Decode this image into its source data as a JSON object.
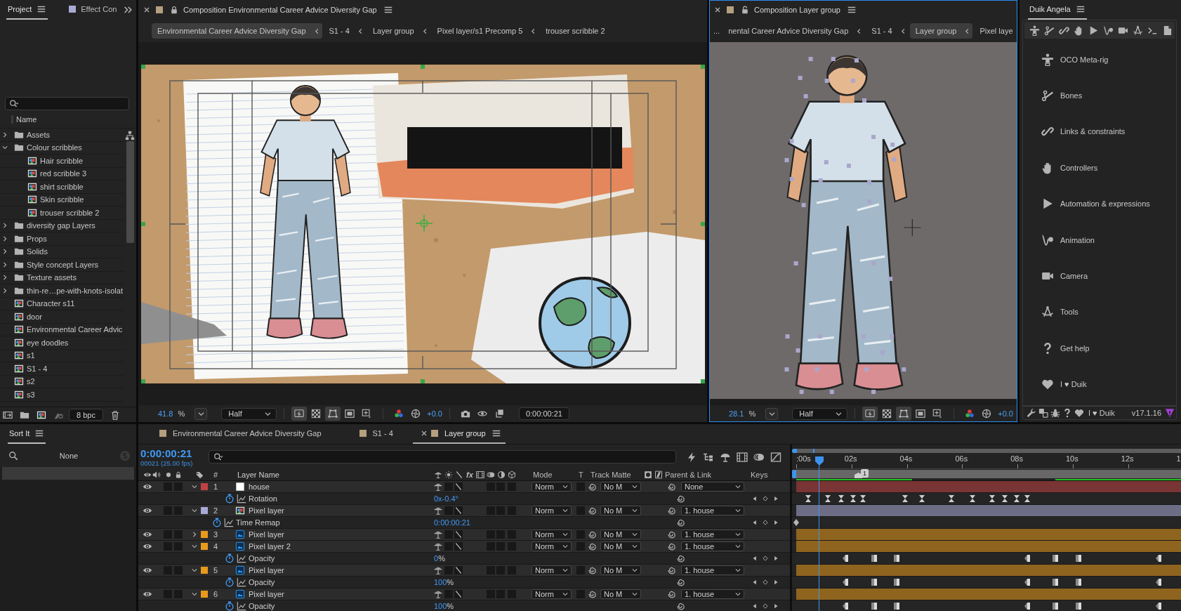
{
  "project": {
    "tabs": [
      {
        "label": "Project",
        "selected": true
      },
      {
        "label": "Effect Con",
        "selected": false,
        "color": "#a9a9d6"
      }
    ],
    "columns": [
      "Name"
    ],
    "items": [
      {
        "kind": "folder",
        "label": "Assets",
        "expanded": false
      },
      {
        "kind": "folder",
        "label": "Colour scribbles",
        "expanded": true,
        "children": [
          {
            "kind": "comp",
            "label": "Hair scribble"
          },
          {
            "kind": "comp",
            "label": "red scribble 3"
          },
          {
            "kind": "comp",
            "label": "shirt scribble"
          },
          {
            "kind": "comp",
            "label": "Skin scribble"
          },
          {
            "kind": "comp",
            "label": "trouser scribble 2"
          }
        ]
      },
      {
        "kind": "folder",
        "label": "diversity gap Layers",
        "expanded": false
      },
      {
        "kind": "folder",
        "label": "Props",
        "expanded": false
      },
      {
        "kind": "folder",
        "label": "Solids",
        "expanded": false
      },
      {
        "kind": "folder",
        "label": "Style concept Layers",
        "expanded": false
      },
      {
        "kind": "folder",
        "label": "Texture assets",
        "expanded": false
      },
      {
        "kind": "folder",
        "label": "thin-re…pe-with-knots-isolat",
        "expanded": false
      },
      {
        "kind": "comp",
        "label": "Character s11"
      },
      {
        "kind": "comp",
        "label": "door"
      },
      {
        "kind": "comp",
        "label": "Environmental Career Advic"
      },
      {
        "kind": "comp",
        "label": "eye doodles"
      },
      {
        "kind": "comp",
        "label": "s1"
      },
      {
        "kind": "comp",
        "label": "S1 - 4"
      },
      {
        "kind": "comp",
        "label": "s2"
      },
      {
        "kind": "comp",
        "label": "s3"
      }
    ],
    "bit_depth": "8 bpc"
  },
  "viewers": [
    {
      "kind": "composition",
      "active": false,
      "title": "Composition Environmental Career Advice Diversity Gap",
      "color": "#b49f7e",
      "locked": true,
      "breadcrumbs": [
        {
          "label": "Environmental Career Advice Diversity Gap",
          "selected": true
        },
        {
          "label": "S1 - 4",
          "selected": false
        },
        {
          "label": "Layer group",
          "selected": false
        },
        {
          "label": "Pixel layer/s1 Precomp 5",
          "selected": false
        },
        {
          "label": "trouser scribble 2",
          "selected": false
        }
      ],
      "magnification": "41.8",
      "unit": "%",
      "resolution": "Half",
      "toggles": [
        {
          "kind": "fast-preview",
          "on": true
        },
        {
          "kind": "transparency",
          "on": false
        },
        {
          "kind": "mask",
          "on": true
        },
        {
          "kind": "region",
          "on": false
        },
        {
          "kind": "grid",
          "on": false
        }
      ],
      "exposure": "+0.0",
      "timecode": "0:00:00:21"
    },
    {
      "kind": "layer",
      "active": true,
      "title": "Composition Layer group",
      "color": "#b49f7e",
      "locked": false,
      "breadcrumb_overflow": "...",
      "breadcrumbs": [
        {
          "label": "nental Career Advice Diversity Gap",
          "selected": false
        },
        {
          "label": "S1 - 4",
          "selected": false
        },
        {
          "label": "Layer group",
          "selected": true
        },
        {
          "label": "Pixel laye",
          "selected": false
        }
      ],
      "magnification": "28.1",
      "unit": "%",
      "resolution": "Half",
      "toggles": [
        {
          "kind": "fast-preview",
          "on": true
        },
        {
          "kind": "transparency",
          "on": false
        },
        {
          "kind": "mask",
          "on": true
        },
        {
          "kind": "region",
          "on": false
        },
        {
          "kind": "grid",
          "on": false
        }
      ],
      "exposure": "+0.0"
    }
  ],
  "duik": {
    "title": "Duik Angela",
    "toolbar": [
      {
        "kind": "meta-rig"
      },
      {
        "kind": "bones"
      },
      {
        "kind": "links"
      },
      {
        "kind": "controllers"
      },
      {
        "kind": "automation"
      },
      {
        "kind": "animation"
      },
      {
        "kind": "camera"
      },
      {
        "kind": "tools"
      },
      {
        "kind": "terminal"
      },
      {
        "kind": "document"
      }
    ],
    "items": [
      {
        "kind": "meta-rig",
        "label": "OCO Meta-rig"
      },
      {
        "kind": "bones",
        "label": "Bones"
      },
      {
        "kind": "links",
        "label": "Links & constraints"
      },
      {
        "kind": "controllers",
        "label": "Controllers"
      },
      {
        "kind": "automation",
        "label": "Automation & expressions"
      },
      {
        "kind": "animation",
        "label": "Animation"
      },
      {
        "kind": "camera",
        "label": "Camera"
      },
      {
        "kind": "tools",
        "label": "Tools"
      },
      {
        "kind": "help",
        "label": "Get help"
      },
      {
        "kind": "heart",
        "label": "I ♥ Duik"
      }
    ],
    "footer": {
      "tools": [
        {
          "kind": "settings"
        },
        {
          "kind": "translate"
        },
        {
          "kind": "bug"
        },
        {
          "kind": "help"
        },
        {
          "kind": "heart"
        }
      ],
      "credit": "I ♥ Duik",
      "version": "v17.1.16"
    }
  },
  "sort_it": {
    "title": "Sort It",
    "filter": "None",
    "rows": [
      {
        "selected": true
      }
    ]
  },
  "timeline": {
    "tabs": [
      {
        "label": "Environmental Career Advice Diversity Gap",
        "color": "#b49f7e",
        "selected": false
      },
      {
        "label": "S1 - 4",
        "color": "#b49f7e",
        "selected": false
      },
      {
        "label": "Layer group",
        "color": "#b49f7e",
        "selected": true
      }
    ],
    "timecode": "0:00:00:21",
    "frame_info": "00021 (25.00 fps)",
    "columns": {
      "number": "#",
      "layer_name": "Layer Name",
      "effects": "fx",
      "mode": "Mode",
      "preserve": "T",
      "track_matte": "Track Matte",
      "parent": "Parent & Link",
      "keys": "Keys"
    },
    "layers": [
      {
        "number": "1",
        "name": "house",
        "kind": "solid",
        "color": "#c04141",
        "visible": true,
        "solo": false,
        "locked": false,
        "expanded": true,
        "collapse": false,
        "motion_blur": false,
        "adjustment": false,
        "three_d": false,
        "mode": "Norm",
        "preserve_transparency": false,
        "track_matte": "No M",
        "parent": "None",
        "children": [
          {
            "kind": "transform",
            "name": "Rotation",
            "value": "0x-0.4°",
            "animated": true
          }
        ]
      },
      {
        "number": "2",
        "name": "Pixel layer",
        "kind": "comp",
        "color": "#a9a9d7",
        "visible": true,
        "solo": false,
        "locked": false,
        "expanded": true,
        "collapse": false,
        "motion_blur": false,
        "adjustment": false,
        "three_d": false,
        "mode": "Norm",
        "preserve_transparency": false,
        "track_matte": "No M",
        "parent": "1. house",
        "children": [
          {
            "kind": "layer-property",
            "name": "Time Remap",
            "value": "0:00:00:21",
            "animated": true
          }
        ]
      },
      {
        "number": "3",
        "name": "Pixel layer",
        "kind": "image",
        "color": "#e89a1c",
        "visible": true,
        "solo": false,
        "locked": false,
        "expanded": false,
        "collapse": false,
        "motion_blur": false,
        "adjustment": false,
        "three_d": false,
        "mode": "Norm",
        "preserve_transparency": false,
        "track_matte": "No M",
        "parent": "1. house"
      },
      {
        "number": "4",
        "name": "Pixel layer 2",
        "kind": "image",
        "color": "#e89a1c",
        "visible": true,
        "solo": false,
        "locked": false,
        "expanded": true,
        "collapse": false,
        "motion_blur": false,
        "adjustment": false,
        "three_d": false,
        "mode": "Norm",
        "preserve_transparency": false,
        "track_matte": "No M",
        "parent": "1. house",
        "children": [
          {
            "kind": "transform",
            "name": "Opacity",
            "value": "0",
            "unit": "%",
            "animated": true
          }
        ]
      },
      {
        "number": "5",
        "name": "Pixel layer",
        "kind": "image",
        "color": "#e89a1c",
        "visible": true,
        "solo": false,
        "locked": false,
        "expanded": true,
        "collapse": false,
        "motion_blur": false,
        "adjustment": false,
        "three_d": false,
        "mode": "Norm",
        "preserve_transparency": false,
        "track_matte": "No M",
        "parent": "1. house",
        "children": [
          {
            "kind": "transform",
            "name": "Opacity",
            "value": "100",
            "unit": "%",
            "animated": true
          }
        ]
      },
      {
        "number": "6",
        "name": "Pixel layer",
        "kind": "image",
        "color": "#e89a1c",
        "visible": true,
        "solo": false,
        "locked": false,
        "expanded": true,
        "collapse": false,
        "motion_blur": false,
        "adjustment": false,
        "three_d": false,
        "mode": "Norm",
        "preserve_transparency": false,
        "track_matte": "No M",
        "parent": "1. house",
        "children": [
          {
            "kind": "transform",
            "name": "Opacity",
            "value": "100",
            "unit": "%",
            "animated": true
          }
        ]
      }
    ],
    "ruler": {
      "ticks": [
        ":00s",
        "02s",
        "04s",
        "06s",
        "08s",
        "10s",
        "12s",
        "1"
      ],
      "level": 0.06
    },
    "marker": "1"
  }
}
